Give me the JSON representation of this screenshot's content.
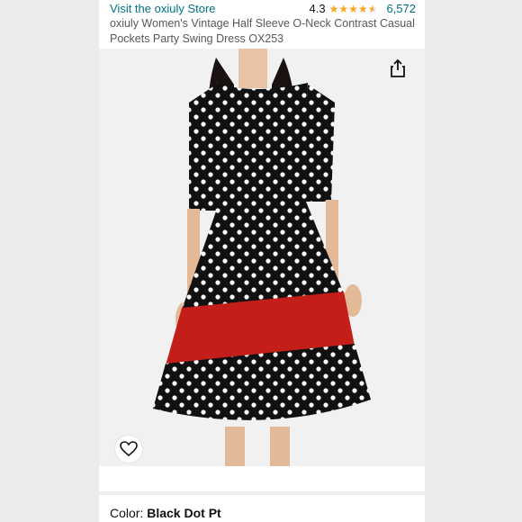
{
  "header": {
    "store_link": "Visit the oxiuly Store",
    "rating_value": "4.3",
    "rating": 4.3,
    "rating_count": "6,572",
    "title": "oxiuly Women's Vintage Half Sleeve O-Neck Contrast Casual Pockets Party Swing Dress OX253"
  },
  "image": {
    "description_icon": "product-photo",
    "share_icon": "share-icon",
    "favorite_icon": "heart-icon"
  },
  "carousel": {
    "items": [
      "image",
      "video",
      "image",
      "image",
      "image",
      "image",
      "video",
      "image"
    ],
    "active_index": 0
  },
  "color": {
    "label": "Color: ",
    "value": "Black Dot Pt"
  },
  "colors": {
    "link": "#007185",
    "star": "#ffa41c",
    "accent_dot": "#0a7d8c",
    "dress_black": "#111111",
    "dress_red": "#c41e1a"
  }
}
